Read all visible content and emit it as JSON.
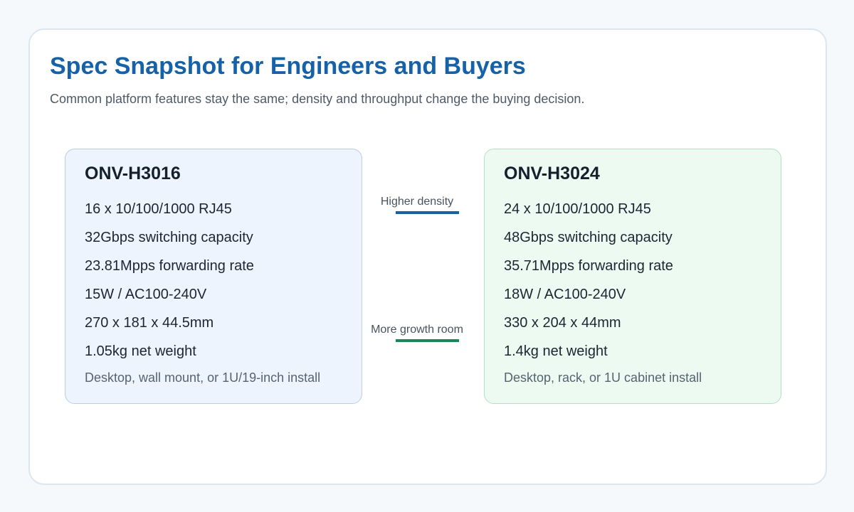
{
  "header": {
    "title": "Spec Snapshot for Engineers and Buyers",
    "subtitle": "Common platform features stay the same; density and throughput change the buying decision."
  },
  "products": [
    {
      "name": "ONV-H3016",
      "specs": [
        "16 x 10/100/1000 RJ45",
        "32Gbps switching capacity",
        "23.81Mpps forwarding rate",
        "15W / AC100-240V",
        "270 x 181 x 44.5mm",
        "1.05kg net weight"
      ],
      "install": "Desktop, wall mount, or 1U/19-inch install"
    },
    {
      "name": "ONV-H3024",
      "specs": [
        "24 x 10/100/1000 RJ45",
        "48Gbps switching capacity",
        "35.71Mpps forwarding rate",
        "18W / AC100-240V",
        "330 x 204 x 44mm",
        "1.4kg net weight"
      ],
      "install": "Desktop, rack, or 1U cabinet install"
    }
  ],
  "differences": [
    {
      "label": "Higher density",
      "color": "#1662a8"
    },
    {
      "label": "More growth room",
      "color": "#138a59"
    }
  ],
  "colors": {
    "title": "#1662a8",
    "left_card_bg": "#eef4fd",
    "right_card_bg": "#edfaf2"
  }
}
